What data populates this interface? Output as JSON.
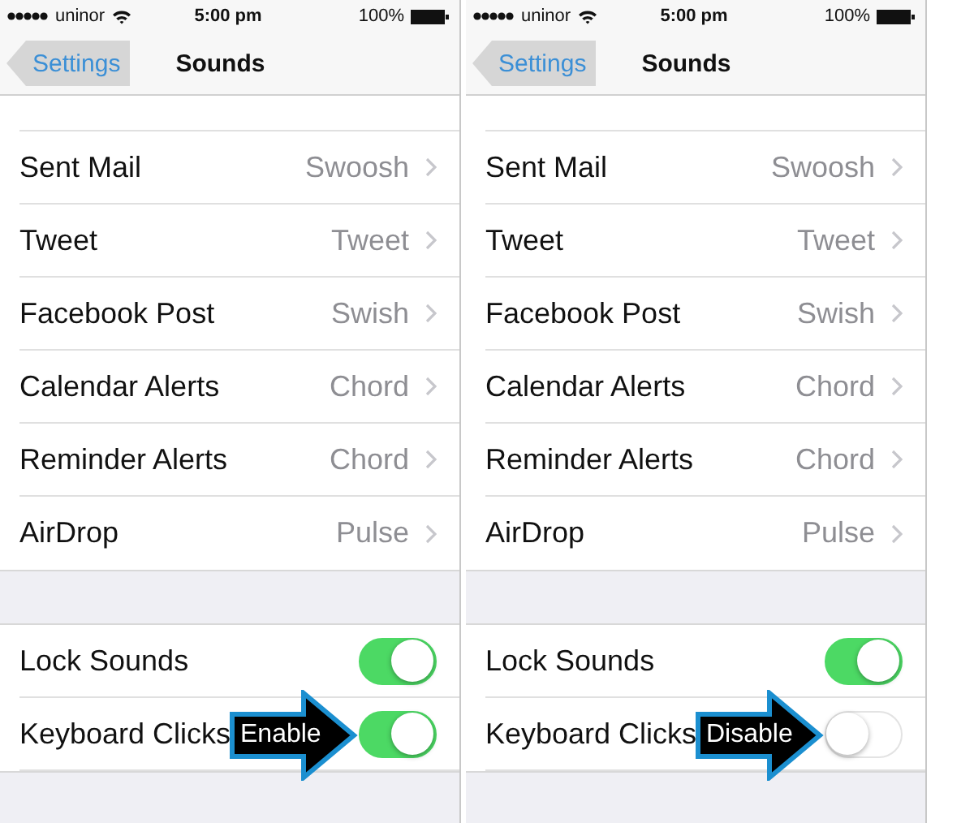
{
  "phones": [
    {
      "status_bar": {
        "carrier": "uninor",
        "time": "5:00 pm",
        "battery": "100%"
      },
      "back_button": "Settings",
      "title": "Sounds",
      "sound_rows": [
        {
          "label": "Sent Mail",
          "value": "Swoosh"
        },
        {
          "label": "Tweet",
          "value": "Tweet"
        },
        {
          "label": "Facebook Post",
          "value": "Swish"
        },
        {
          "label": "Calendar Alerts",
          "value": "Chord"
        },
        {
          "label": "Reminder Alerts",
          "value": "Chord"
        },
        {
          "label": "AirDrop",
          "value": "Pulse"
        }
      ],
      "toggle_rows": [
        {
          "label": "Lock Sounds",
          "on": true
        },
        {
          "label": "Keyboard Clicks",
          "on": true
        }
      ],
      "callout": "Enable"
    },
    {
      "status_bar": {
        "carrier": "uninor",
        "time": "5:00 pm",
        "battery": "100%"
      },
      "back_button": "Settings",
      "title": "Sounds",
      "sound_rows": [
        {
          "label": "Sent Mail",
          "value": "Swoosh"
        },
        {
          "label": "Tweet",
          "value": "Tweet"
        },
        {
          "label": "Facebook Post",
          "value": "Swish"
        },
        {
          "label": "Calendar Alerts",
          "value": "Chord"
        },
        {
          "label": "Reminder Alerts",
          "value": "Chord"
        },
        {
          "label": "AirDrop",
          "value": "Pulse"
        }
      ],
      "toggle_rows": [
        {
          "label": "Lock Sounds",
          "on": true
        },
        {
          "label": "Keyboard Clicks",
          "on": false
        }
      ],
      "callout": "Disable"
    }
  ]
}
